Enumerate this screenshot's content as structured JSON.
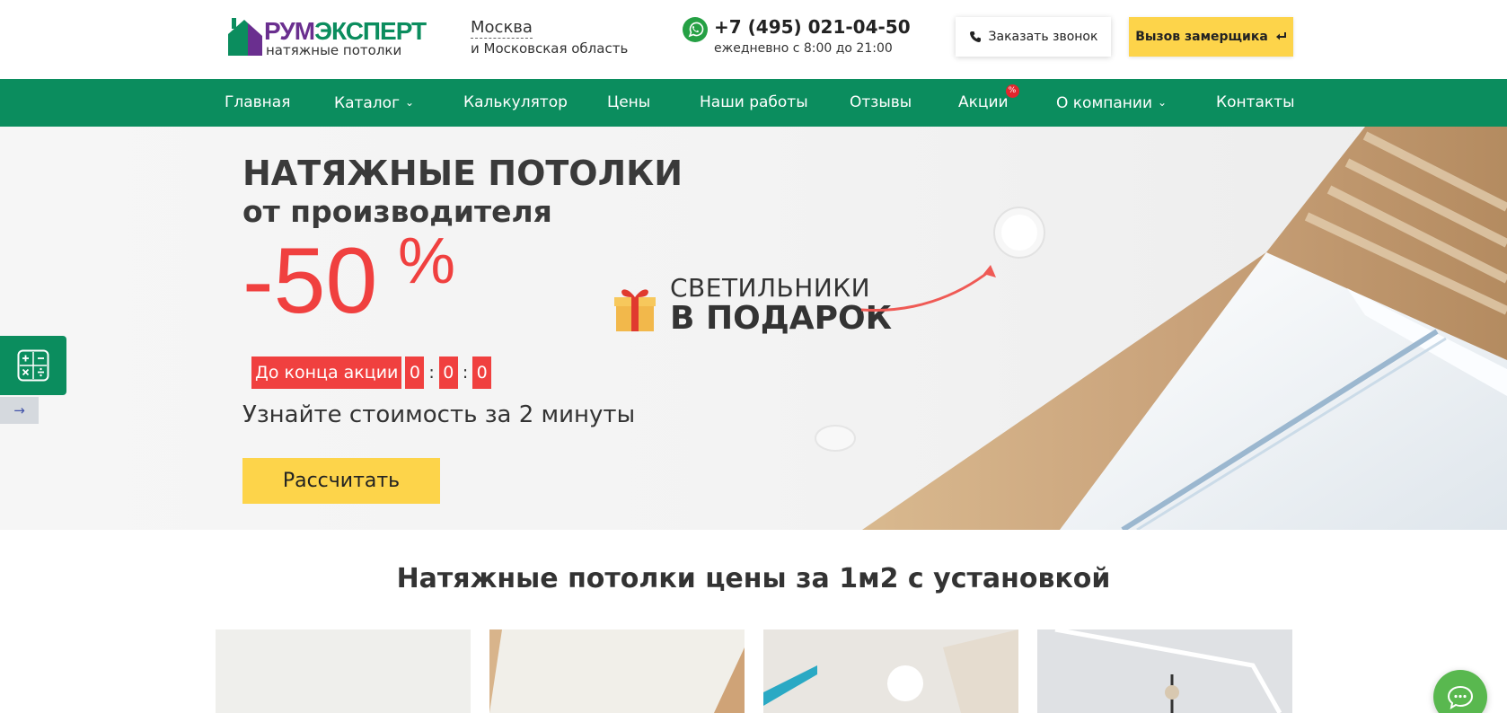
{
  "header": {
    "logo": {
      "part1": "РУМ",
      "part2": "ЭКСПЕРТ",
      "subtitle": "натяжные потолки"
    },
    "city": {
      "name": "Москва",
      "region": "и Московская область"
    },
    "phone": {
      "number": "+7 (495) 021-04-50",
      "hours": "ежедневно с 8:00 до 21:00",
      "icon": "whatsapp-icon"
    },
    "call_button": "Заказать звонок",
    "measure_button": "Вызов замерщика"
  },
  "nav": {
    "items": [
      {
        "label": "Главная"
      },
      {
        "label": "Каталог",
        "dropdown": true
      },
      {
        "label": "Калькулятор"
      },
      {
        "label": "Цены"
      },
      {
        "label": "Наши работы"
      },
      {
        "label": "Отзывы"
      },
      {
        "label": "Акции",
        "badge": "%"
      },
      {
        "label": "О компании",
        "dropdown": true
      },
      {
        "label": "Контакты"
      }
    ]
  },
  "hero": {
    "title": "НАТЯЖНЫЕ ПОТОЛКИ",
    "subtitle": "от производителя",
    "discount": "-50",
    "percent": "%",
    "timer": {
      "label": "До конца акции",
      "values": [
        "0",
        "0",
        "0"
      ],
      "separator": ":"
    },
    "cost_text": "Узнайте стоимость за 2 минуты",
    "calc_button": "Рассчитать",
    "gift": {
      "line1": "СВЕТИЛЬНИКИ",
      "line2": "В ПОДАРОК"
    }
  },
  "side": {
    "arrow": "→"
  },
  "prices_section": {
    "title": "Натяжные потолки цены за 1м2 с установкой"
  },
  "colors": {
    "green": "#0b8d5e",
    "yellow": "#fdd44a",
    "red": "#f0403f",
    "purple": "#6a2f8f"
  }
}
